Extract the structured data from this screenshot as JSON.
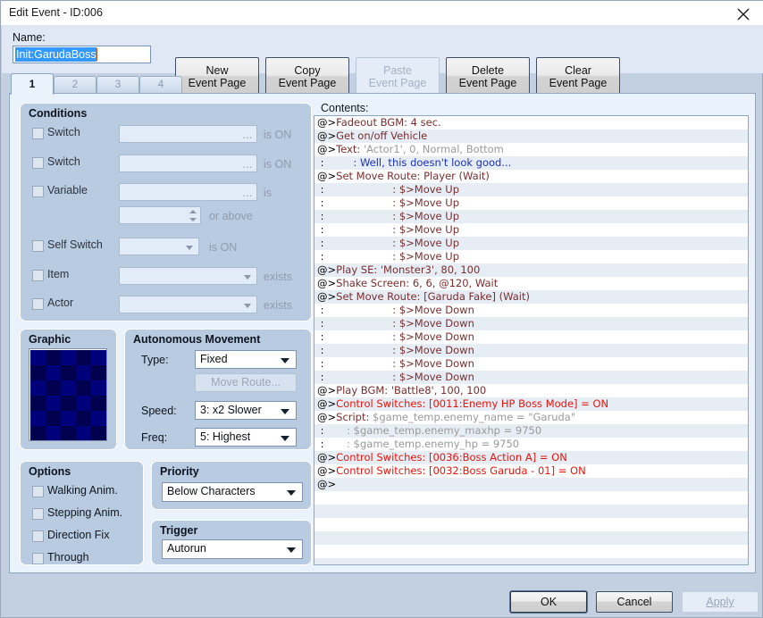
{
  "window": {
    "title": "Edit Event - ID:006",
    "close_icon": "close-icon"
  },
  "header": {
    "name_label": "Name:",
    "name_value": "Init:GarudaBoss",
    "buttons": [
      {
        "id": "new",
        "label": "New\nEvent Page",
        "disabled": false
      },
      {
        "id": "copy",
        "label": "Copy\nEvent Page",
        "disabled": false
      },
      {
        "id": "paste",
        "label": "Paste\nEvent Page",
        "disabled": true
      },
      {
        "id": "delete",
        "label": "Delete\nEvent Page",
        "disabled": false
      },
      {
        "id": "clear",
        "label": "Clear\nEvent Page",
        "disabled": false
      }
    ]
  },
  "tabs": [
    {
      "label": "1",
      "active": true
    },
    {
      "label": "2",
      "active": false
    },
    {
      "label": "3",
      "active": false
    },
    {
      "label": "4",
      "active": false
    }
  ],
  "conditions": {
    "title": "Conditions",
    "rows": [
      {
        "label": "Switch",
        "checked": false,
        "value": "",
        "suffix": "is ON"
      },
      {
        "label": "Switch",
        "checked": false,
        "value": "",
        "suffix": "is ON"
      },
      {
        "label": "Variable",
        "checked": false,
        "value": "",
        "suffix": "is"
      },
      {
        "label": "",
        "checked": false,
        "value": "",
        "suffix": "or above"
      },
      {
        "label": "Self Switch",
        "checked": false,
        "value": "",
        "suffix": "is ON"
      },
      {
        "label": "Item",
        "checked": false,
        "value": "",
        "suffix": "exists"
      },
      {
        "label": "Actor",
        "checked": false,
        "value": "",
        "suffix": "exists"
      }
    ]
  },
  "graphic": {
    "title": "Graphic",
    "preview_colors": {
      "light": "#00007a",
      "dark": "#00004e"
    }
  },
  "autonomous_movement": {
    "title": "Autonomous Movement",
    "type_label": "Type:",
    "type_value": "Fixed",
    "move_route_label": "Move Route...",
    "move_route_disabled": true,
    "speed_label": "Speed:",
    "speed_value": "3: x2 Slower",
    "freq_label": "Freq:",
    "freq_value": "5: Highest"
  },
  "options": {
    "title": "Options",
    "items": [
      {
        "label": "Walking Anim.",
        "checked": false
      },
      {
        "label": "Stepping Anim.",
        "checked": false
      },
      {
        "label": "Direction Fix",
        "checked": false
      },
      {
        "label": "Through",
        "checked": false
      }
    ]
  },
  "priority": {
    "title": "Priority",
    "value": "Below Characters"
  },
  "trigger": {
    "title": "Trigger",
    "value": "Autorun"
  },
  "contents": {
    "label": "Contents:",
    "lines": [
      {
        "at": "@>",
        "cmd": "Fadeout BGM: 4 sec.",
        "param": "",
        "kind": "cmd"
      },
      {
        "at": "@>",
        "cmd": "Get on/off Vehicle",
        "param": "",
        "kind": "cmd"
      },
      {
        "at": "@>",
        "cmd": "Text: ",
        "param": "'Actor1', 0, Normal, Bottom",
        "kind": "cmd-param"
      },
      {
        "at": " : ",
        "cmd": "        : Well, this doesn't look good...",
        "param": "",
        "kind": "dialogue"
      },
      {
        "at": "@>",
        "cmd": "Set Move Route: Player (Wait)",
        "param": "",
        "kind": "cmd"
      },
      {
        "at": " : ",
        "cmd": "                    : $>Move Up",
        "param": "",
        "kind": "cmd"
      },
      {
        "at": " : ",
        "cmd": "                    : $>Move Up",
        "param": "",
        "kind": "cmd"
      },
      {
        "at": " : ",
        "cmd": "                    : $>Move Up",
        "param": "",
        "kind": "cmd"
      },
      {
        "at": " : ",
        "cmd": "                    : $>Move Up",
        "param": "",
        "kind": "cmd"
      },
      {
        "at": " : ",
        "cmd": "                    : $>Move Up",
        "param": "",
        "kind": "cmd"
      },
      {
        "at": " : ",
        "cmd": "                    : $>Move Up",
        "param": "",
        "kind": "cmd"
      },
      {
        "at": "@>",
        "cmd": "Play SE: 'Monster3', 80, 100",
        "param": "",
        "kind": "cmd"
      },
      {
        "at": "@>",
        "cmd": "Shake Screen: 6, 6, @120, Wait",
        "param": "",
        "kind": "cmd"
      },
      {
        "at": "@>",
        "cmd": "Set Move Route: [Garuda Fake] (Wait)",
        "param": "",
        "kind": "cmd"
      },
      {
        "at": " : ",
        "cmd": "                    : $>Move Down",
        "param": "",
        "kind": "cmd"
      },
      {
        "at": " : ",
        "cmd": "                    : $>Move Down",
        "param": "",
        "kind": "cmd"
      },
      {
        "at": " : ",
        "cmd": "                    : $>Move Down",
        "param": "",
        "kind": "cmd"
      },
      {
        "at": " : ",
        "cmd": "                    : $>Move Down",
        "param": "",
        "kind": "cmd"
      },
      {
        "at": " : ",
        "cmd": "                    : $>Move Down",
        "param": "",
        "kind": "cmd"
      },
      {
        "at": " : ",
        "cmd": "                    : $>Move Down",
        "param": "",
        "kind": "cmd"
      },
      {
        "at": "@>",
        "cmd": "Play BGM: 'Battle8', 100, 100",
        "param": "",
        "kind": "cmd"
      },
      {
        "at": "@>",
        "cmd": "Control Switches: [0011:Enemy HP Boss Mode] = ON",
        "param": "",
        "kind": "switch"
      },
      {
        "at": "@>",
        "cmd": "Script: ",
        "param": "$game_temp.enemy_name = \"Garuda\"",
        "kind": "cmd-param"
      },
      {
        "at": " : ",
        "cmd": "",
        "param": "      : $game_temp.enemy_maxhp = 9750",
        "kind": "script-cont"
      },
      {
        "at": " : ",
        "cmd": "",
        "param": "      : $game_temp.enemy_hp = 9750",
        "kind": "script-cont"
      },
      {
        "at": "@>",
        "cmd": "Control Switches: [0036:Boss Action A] = ON",
        "param": "",
        "kind": "switch"
      },
      {
        "at": "@>",
        "cmd": "Control Switches: [0032:Boss Garuda - 01] = ON",
        "param": "",
        "kind": "switch"
      },
      {
        "at": "@>",
        "cmd": "",
        "param": "",
        "kind": "cmd"
      }
    ]
  },
  "footer": {
    "ok": "OK",
    "cancel": "Cancel",
    "apply": "Apply",
    "apply_disabled": true
  },
  "colors": {
    "window_bg": "#c3d0e2",
    "panel_bg": "#eaf2fb",
    "group_bg": "#b9cbe0",
    "command": "#7b2d2d",
    "switch_red": "#e8140a",
    "dialogue_blue": "#1a31c0",
    "param_gray": "#9a9a9a",
    "row_alt": "#e7edf5"
  }
}
